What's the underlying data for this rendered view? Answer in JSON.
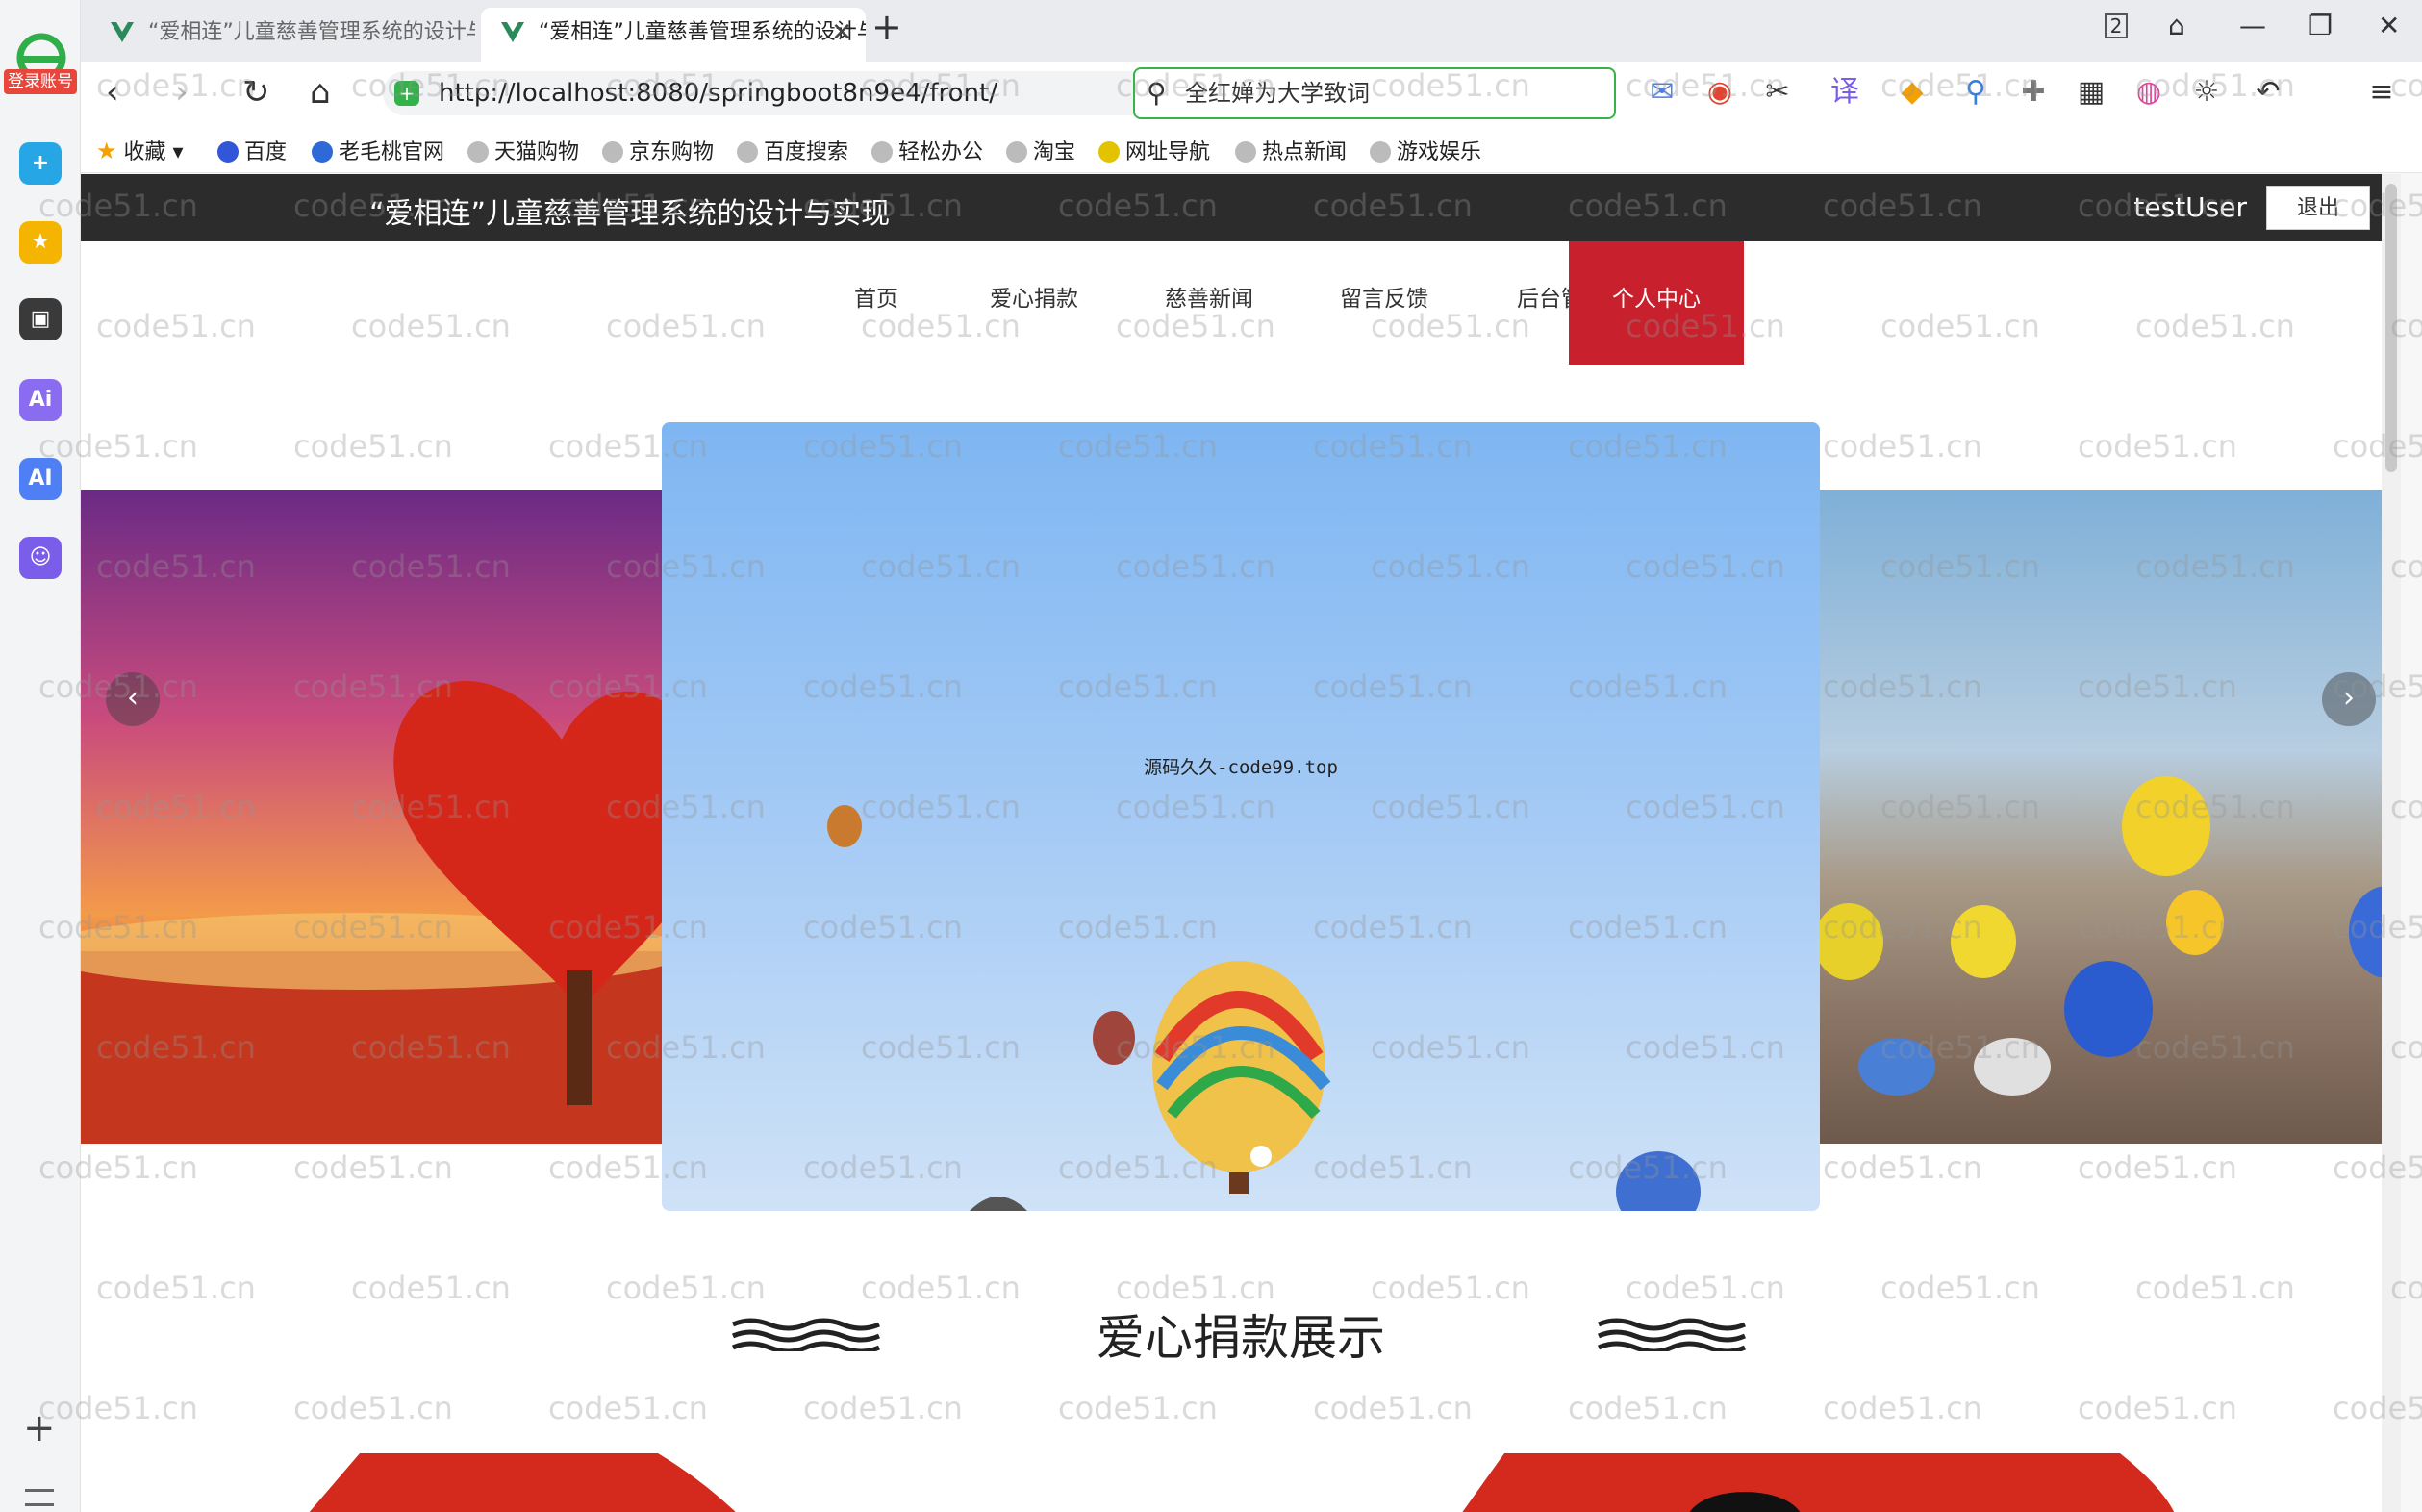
{
  "sidebar": {
    "login_badge": "登录账号"
  },
  "tabs": [
    {
      "title": "“爱相连”儿童慈善管理系统的设计与实现",
      "active": false
    },
    {
      "title": "“爱相连”儿童慈善管理系统的设计与实现",
      "active": true
    }
  ],
  "window": {
    "tab_count_badge": "2"
  },
  "toolbar": {
    "url": "http://localhost:8080/springboot8n9e4/front/",
    "search_value": "全红婵为大学致词"
  },
  "bookmarks": [
    {
      "label": "收藏"
    },
    {
      "label": "百度"
    },
    {
      "label": "老毛桃官网"
    },
    {
      "label": "天猫购物"
    },
    {
      "label": "京东购物"
    },
    {
      "label": "百度搜索"
    },
    {
      "label": "轻松办公"
    },
    {
      "label": "淘宝"
    },
    {
      "label": "网址导航"
    },
    {
      "label": "热点新闻"
    },
    {
      "label": "游戏娱乐"
    }
  ],
  "site": {
    "title": "“爱相连”儿童慈善管理系统的设计与实现",
    "username": "testUser",
    "logout_label": "退出",
    "nav": [
      {
        "label": "首页"
      },
      {
        "label": "爱心捐款"
      },
      {
        "label": "慈善新闻"
      },
      {
        "label": "留言反馈"
      },
      {
        "label": "后台管理"
      },
      {
        "label": "个人中心",
        "active": true
      }
    ],
    "carousel_caption": "源码久久-code99.top",
    "section_title": "爱心捐款展示",
    "accent_color": "#c8202c"
  },
  "watermark_text": "code51.cn"
}
